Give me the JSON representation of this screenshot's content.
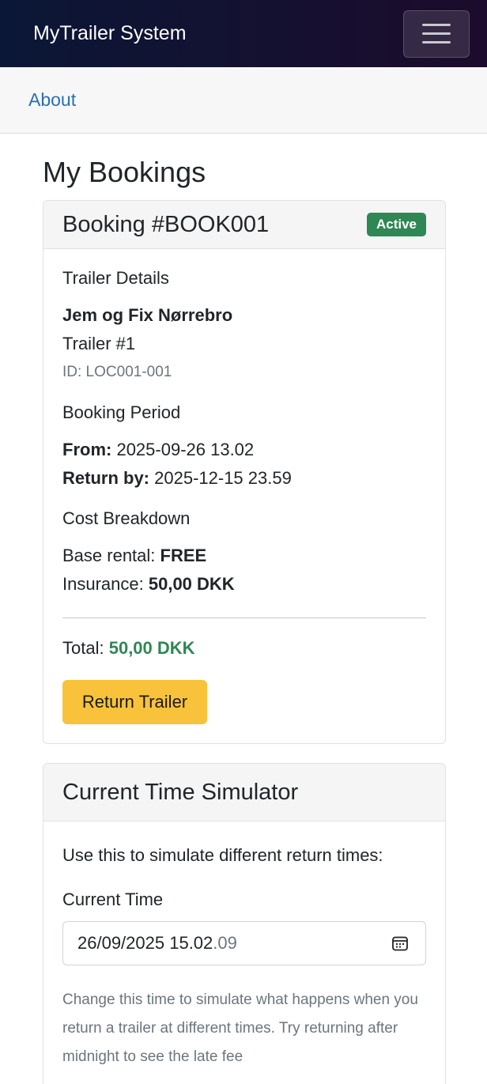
{
  "app": {
    "brand": "MyTrailer System"
  },
  "subnav": {
    "about": "About"
  },
  "page": {
    "title": "My Bookings"
  },
  "booking": {
    "title": "Booking #BOOK001",
    "status": "Active",
    "trailer_section": "Trailer Details",
    "location": "Jem og Fix Nørrebro",
    "trailer": "Trailer #1",
    "id": "ID: LOC001-001",
    "period_section": "Booking Period",
    "from_label": "From:",
    "from_value": "2025-09-26 13.02",
    "return_label": "Return by:",
    "return_value": "2025-12-15 23.59",
    "cost_section": "Cost Breakdown",
    "base_label": "Base rental:",
    "base_value": "FREE",
    "insurance_label": "Insurance:",
    "insurance_value": "50,00 DKK",
    "total_label": "Total:",
    "total_value": "50,00 DKK",
    "return_button": "Return Trailer"
  },
  "simulator": {
    "title": "Current Time Simulator",
    "description": "Use this to simulate different return times:",
    "field_label": "Current Time",
    "value_main": "26/09/2025 15.02",
    "value_seconds": "09",
    "help": "Change this time to simulate what happens when you return a trailer at different times. Try returning after midnight to see the late fee"
  },
  "colors": {
    "active_badge": "#2f8755",
    "return_button": "#f8c23a",
    "link": "#2a6fb5"
  }
}
